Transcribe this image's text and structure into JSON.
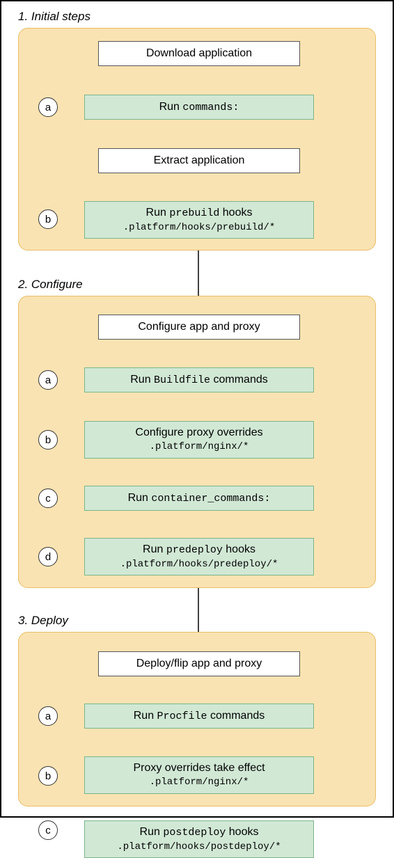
{
  "sections": [
    {
      "title": "1. Initial steps"
    },
    {
      "title": "2. Configure"
    },
    {
      "title": "3. Deploy"
    }
  ],
  "boxes": {
    "s1b1": {
      "main": "Download application"
    },
    "s1b2": {
      "main": "Run <code>commands:</code>"
    },
    "s1b3": {
      "main": "Extract application"
    },
    "s1b4": {
      "main": "Run <code>prebuild</code> hooks",
      "sub": ".platform/hooks/prebuild/*"
    },
    "s2b1": {
      "main": "Configure app and proxy"
    },
    "s2b2": {
      "main": "Run <code>Buildfile</code> commands"
    },
    "s2b3": {
      "main": "Configure proxy overrides",
      "sub": ".platform/nginx/*"
    },
    "s2b4": {
      "main": "Run <code>container_commands:</code>"
    },
    "s2b5": {
      "main": "Run <code>predeploy</code> hooks",
      "sub": ".platform/hooks/predeploy/*"
    },
    "s3b1": {
      "main": "Deploy/flip app and proxy"
    },
    "s3b2": {
      "main": "Run <code>Procfile</code> commands"
    },
    "s3b3": {
      "main": "Proxy overrides take effect",
      "sub": ".platform/nginx/*"
    },
    "s3b4": {
      "main": "Run <code>postdeploy</code> hooks",
      "sub": ".platform/hooks/postdeploy/*"
    }
  },
  "badges": {
    "s1a": "a",
    "s1b": "b",
    "s2a": "a",
    "s2b": "b",
    "s2c": "c",
    "s2d": "d",
    "s3a": "a",
    "s3b": "b",
    "s3c": "c"
  }
}
